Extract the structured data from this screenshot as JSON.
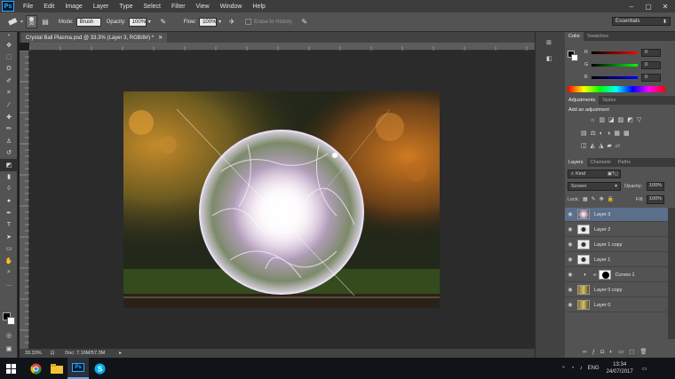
{
  "app": {
    "logo": "Ps"
  },
  "menu": [
    "File",
    "Edit",
    "Image",
    "Layer",
    "Type",
    "Select",
    "Filter",
    "View",
    "Window",
    "Help"
  ],
  "options": {
    "brush_size": "30",
    "mode_label": "Mode:",
    "mode_value": "Brush",
    "opacity_label": "Opacity:",
    "opacity_value": "100%",
    "flow_label": "Flow:",
    "flow_value": "100%",
    "erase_history": "Erase to History",
    "workspace": "Essentials"
  },
  "document": {
    "tab_title": "Crystal Ball Plasma.psd @ 33.3% (Layer 3, RGB/8#) *"
  },
  "status": {
    "zoom": "33.33%",
    "doc": "Doc: 7.16M/57.3M"
  },
  "color_panel": {
    "tabs": [
      "Color",
      "Swatches"
    ],
    "channels": [
      {
        "label": "R",
        "value": "0"
      },
      {
        "label": "G",
        "value": "0"
      },
      {
        "label": "B",
        "value": "0"
      }
    ]
  },
  "adjustments_panel": {
    "tabs": [
      "Adjustments",
      "Styles"
    ],
    "heading": "Add an adjustment"
  },
  "layers_panel": {
    "tabs": [
      "Layers",
      "Channels",
      "Paths"
    ],
    "kind": "Kind",
    "blend_mode": "Screen",
    "opacity_label": "Opacity:",
    "opacity_value": "100%",
    "lock_label": "Lock:",
    "fill_label": "Fill:",
    "fill_value": "100%",
    "layers": [
      {
        "name": "Layer 3",
        "selected": true
      },
      {
        "name": "Layer 2",
        "selected": false
      },
      {
        "name": "Layer 1 copy",
        "selected": false
      },
      {
        "name": "Layer 1",
        "selected": false
      },
      {
        "name": "Curves 1",
        "selected": false
      },
      {
        "name": "Layer 0 copy",
        "selected": false
      },
      {
        "name": "Layer 0",
        "selected": false
      }
    ]
  },
  "taskbar": {
    "lang": "ENG",
    "time": "13:34",
    "date": "24/07/2017"
  }
}
